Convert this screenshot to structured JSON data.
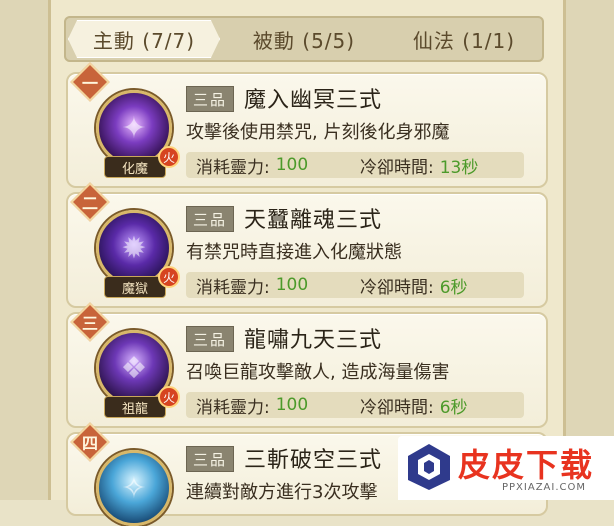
{
  "tabs": [
    {
      "label": "主動 (7/7)",
      "active": true
    },
    {
      "label": "被動 (5/5)",
      "active": false
    },
    {
      "label": "仙法 (1/1)",
      "active": false
    }
  ],
  "cost_label": "消耗靈力:",
  "cooldown_label": "冷卻時間:",
  "grade_label": "三品",
  "element_label": "火",
  "skills": [
    {
      "rank": "一",
      "name": "魔入幽冥三式",
      "skill_tag": "化魔",
      "description": "攻擊後使用禁咒, 片刻後化身邪魔",
      "cost": "100",
      "cooldown": "13秒"
    },
    {
      "rank": "二",
      "name": "天蠶離魂三式",
      "skill_tag": "魔獄",
      "description": "有禁咒時直接進入化魔狀態",
      "cost": "100",
      "cooldown": "6秒"
    },
    {
      "rank": "三",
      "name": "龍嘯九天三式",
      "skill_tag": "祖龍",
      "description": "召喚巨龍攻擊敵人, 造成海量傷害",
      "cost": "100",
      "cooldown": "6秒"
    },
    {
      "rank": "四",
      "name": "三斬破空三式",
      "skill_tag": "",
      "description": "連續對敵方進行3次攻擊",
      "cost": "",
      "cooldown": ""
    }
  ],
  "watermark": {
    "title": "皮皮下载",
    "subtitle": "PPXIAZAI.COM"
  },
  "colors": {
    "value_green": "#4c9a2a",
    "rank_badge": "#c8643a",
    "watermark_red": "#e8331f"
  }
}
